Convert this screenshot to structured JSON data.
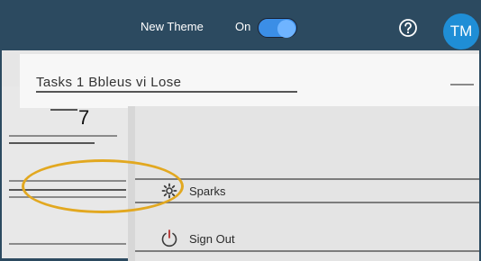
{
  "colors": {
    "topbar": "#2c4a60",
    "toggle_track": "#3b8ee6",
    "toggle_knob": "#6fb4ff",
    "avatar": "#1f8ed6",
    "highlight": "#e2a820"
  },
  "header": {
    "theme_label": "New Theme",
    "toggle_state": "On",
    "help_icon": "question-circle-icon",
    "avatar_initials": "TM"
  },
  "page": {
    "title": "Tasks 1 Bbleus vi Lose",
    "count": "7"
  },
  "menu": {
    "items": [
      {
        "label": "Sparks",
        "icon": "gear-icon"
      },
      {
        "label": "Sign Out",
        "icon": "power-icon"
      }
    ]
  }
}
